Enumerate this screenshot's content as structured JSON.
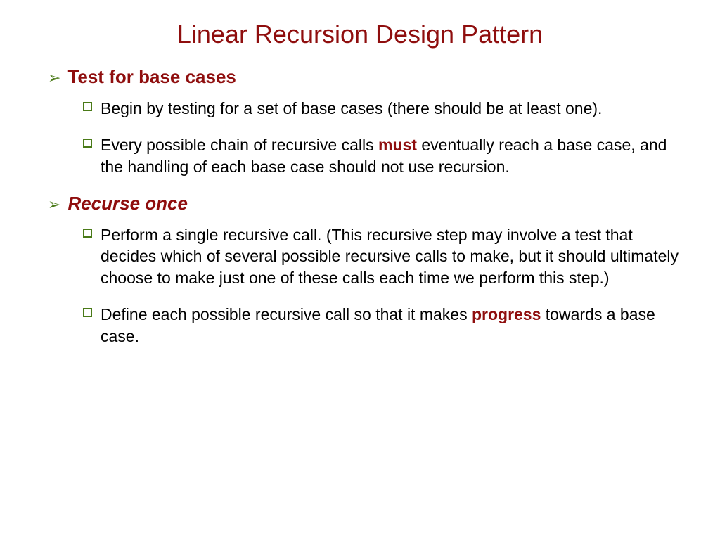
{
  "title": "Linear Recursion Design Pattern",
  "sections": [
    {
      "heading": "Test for base cases",
      "italic": false,
      "items": [
        {
          "pre": "Begin by testing for a set of base cases (there should be at least one).",
          "kw": "",
          "post": ""
        },
        {
          "pre": "Every possible chain of recursive calls ",
          "kw": "must",
          "post": " eventually reach a base case, and the handling of each base case should not use recursion."
        }
      ]
    },
    {
      "heading": "Recurse once",
      "italic": true,
      "items": [
        {
          "pre": "Perform a single recursive call. (This recursive step may involve a test that decides which of several possible recursive calls to make, but it should ultimately choose to make just one of these calls each time we perform this step.)",
          "kw": "",
          "post": ""
        },
        {
          "pre": "Define each possible recursive call so that it makes ",
          "kw": "progress",
          "post": " towards a base case."
        }
      ]
    }
  ]
}
